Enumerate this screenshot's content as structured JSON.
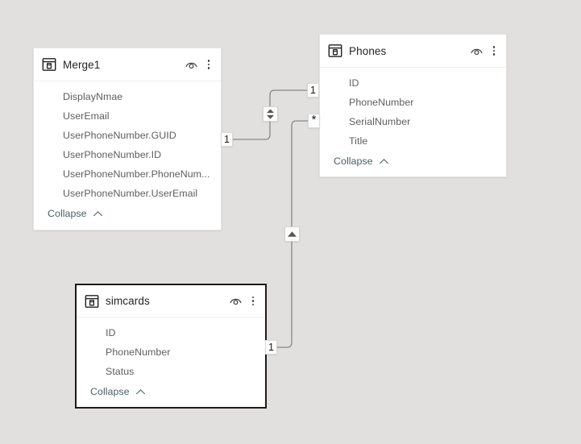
{
  "canvas": {
    "background_color": "#e1e0de",
    "app_area": "model-relationship-diagram"
  },
  "tables": [
    {
      "id": "merge1",
      "name": "Merge1",
      "icon": "table-icon",
      "selected": false,
      "fields": [
        "DisplayNmae",
        "UserEmail",
        "UserPhoneNumber.GUID",
        "UserPhoneNumber.ID",
        "UserPhoneNumber.PhoneNum...",
        "UserPhoneNumber.UserEmail"
      ],
      "collapse_label": "Collapse",
      "hide_icon": "eye-icon",
      "menu_icon": "kebab-menu-icon"
    },
    {
      "id": "phones",
      "name": "Phones",
      "icon": "table-icon",
      "selected": false,
      "fields": [
        "ID",
        "PhoneNumber",
        "SerialNumber",
        "Title"
      ],
      "collapse_label": "Collapse",
      "hide_icon": "eye-icon",
      "menu_icon": "kebab-menu-icon"
    },
    {
      "id": "simcards",
      "name": "simcards",
      "icon": "table-icon",
      "selected": true,
      "fields": [
        "ID",
        "PhoneNumber",
        "Status"
      ],
      "collapse_label": "Collapse",
      "hide_icon": "eye-icon",
      "menu_icon": "kebab-menu-icon"
    }
  ],
  "relationships": [
    {
      "id": "merge1-phones",
      "from_table": "Merge1",
      "to_table": "Phones",
      "from_cardinality": "1",
      "to_cardinality": "1",
      "cross_filter_direction": "both",
      "marker_icon": "both-directions-icon"
    },
    {
      "id": "simcards-phones",
      "from_table": "simcards",
      "to_table": "Phones",
      "from_cardinality": "1",
      "to_cardinality": "*",
      "cross_filter_direction": "single",
      "marker_icon": "single-direction-up-icon"
    }
  ],
  "badges": {
    "merge1_side": "1",
    "phones_top": "1",
    "phones_many": "*",
    "simcards_side": "1"
  },
  "colors": {
    "canvas": "#e1e0de",
    "card": "#ffffff",
    "field_text": "#605e5c",
    "title_text": "#252423",
    "collapse_link": "#4a5f62",
    "line": "#8a8886",
    "selected_border": "#1b1a19"
  }
}
